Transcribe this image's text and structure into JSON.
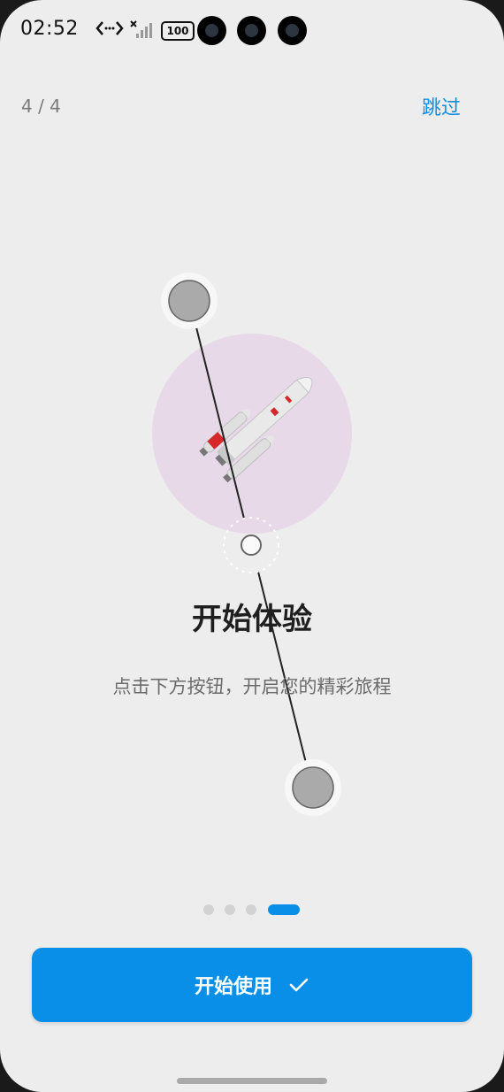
{
  "status_bar": {
    "time": "02:52",
    "battery": "100",
    "icons": [
      "code-arrows-icon",
      "signal-x-icon",
      "battery-icon"
    ]
  },
  "header": {
    "page_indicator": "4 / 4",
    "skip_label": "跳过"
  },
  "hero": {
    "icon": "rocket-icon",
    "circle_color": "#e8d9e8"
  },
  "content": {
    "title": "开始体验",
    "subtitle": "点击下方按钮，开启您的精彩旅程"
  },
  "pagination": {
    "total": 4,
    "active_index": 3
  },
  "cta": {
    "label": "开始使用",
    "icon": "checkmark-icon"
  },
  "colors": {
    "accent": "#0a8fe8",
    "background": "#ededed",
    "title": "#1f1f1f",
    "subtitle": "#6b6b6b"
  }
}
